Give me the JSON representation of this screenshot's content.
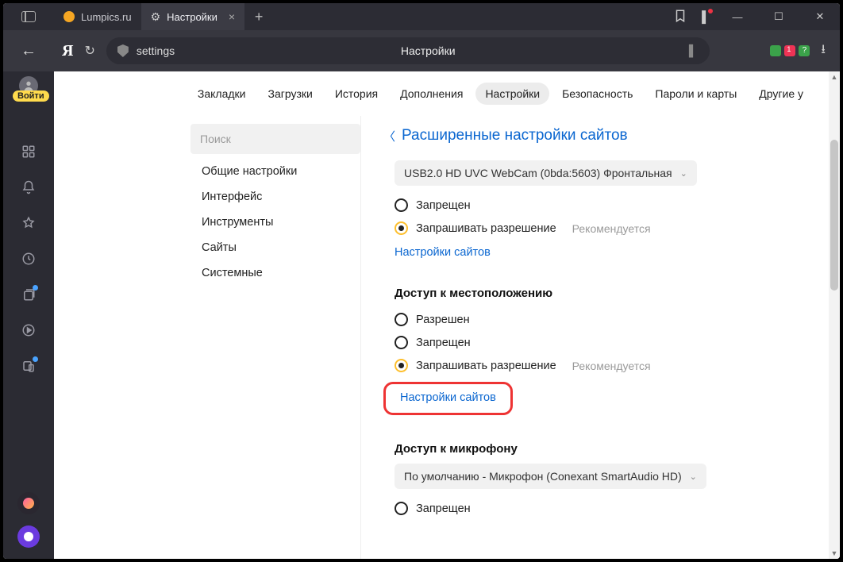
{
  "titlebar": {
    "tabs": [
      {
        "label": "Lumpics.ru",
        "favicon": "#f5a623",
        "active": false
      },
      {
        "label": "Настройки",
        "favicon": "gear",
        "active": true
      }
    ],
    "login_pill": "Войти"
  },
  "addressbar": {
    "url_text": "settings",
    "page_title": "Настройки"
  },
  "topnav": {
    "items": [
      "Закладки",
      "Загрузки",
      "История",
      "Дополнения",
      "Настройки",
      "Безопасность",
      "Пароли и карты",
      "Другие у"
    ],
    "active_index": 4
  },
  "sidebar": {
    "search_placeholder": "Поиск",
    "items": [
      "Общие настройки",
      "Интерфейс",
      "Инструменты",
      "Сайты",
      "Системные"
    ]
  },
  "main": {
    "breadcrumb": "Расширенные настройки сайтов",
    "camera": {
      "device": "USB2.0 HD UVC WebCam (0bda:5603) Фронтальная",
      "opt_deny": "Запрещен",
      "opt_ask": "Запрашивать разрешение",
      "hint": "Рекомендуется",
      "link": "Настройки сайтов"
    },
    "location": {
      "title": "Доступ к местоположению",
      "opt_allow": "Разрешен",
      "opt_deny": "Запрещен",
      "opt_ask": "Запрашивать разрешение",
      "hint": "Рекомендуется",
      "link": "Настройки сайтов"
    },
    "microphone": {
      "title": "Доступ к микрофону",
      "device": "По умолчанию - Микрофон (Conexant SmartAudio HD)",
      "opt_deny": "Запрещен"
    }
  }
}
